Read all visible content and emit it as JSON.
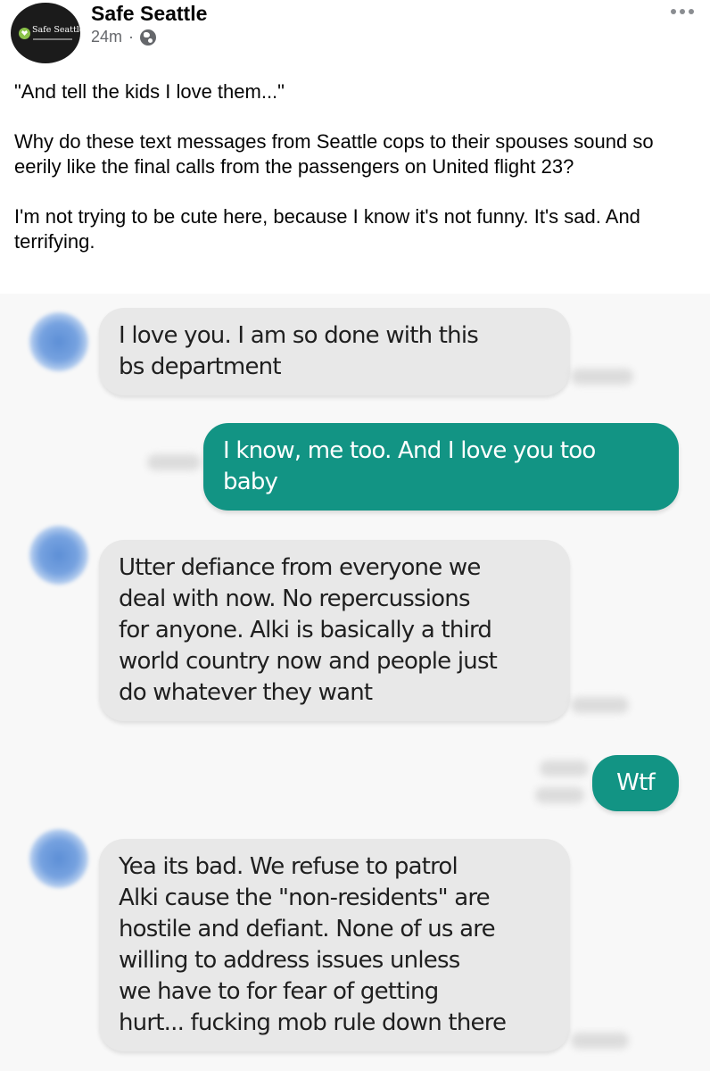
{
  "post": {
    "page_name": "Safe Seattle",
    "logo_text": "Safe Seattle",
    "time_ago": "24m",
    "separator": "·",
    "audience_icon": "globe-icon",
    "menu_icon": "more-horizontal-icon",
    "paragraphs": [
      "\"And tell the kids I love them...\"",
      "Why do these text messages from Seattle cops to their spouses sound so eerily like the final calls from the passengers on United flight 23?",
      "I'm not trying to be cute here, because I know it's not funny. It's sad. And terrifying."
    ]
  },
  "conversation": {
    "colors": {
      "incoming_bubble": "#e8e8e8",
      "outgoing_bubble": "#129484",
      "background": "#f8f8f8"
    },
    "messages": [
      {
        "direction": "incoming",
        "lines": [
          "I love you. I am so done with this",
          "bs department"
        ]
      },
      {
        "direction": "outgoing",
        "lines": [
          "I know, me too. And I love you too",
          "baby"
        ]
      },
      {
        "direction": "incoming",
        "lines": [
          "Utter defiance from everyone we",
          "deal with now. No repercussions",
          "for anyone. Alki is basically a third",
          "world country now and people just",
          "do whatever they want"
        ]
      },
      {
        "direction": "outgoing",
        "lines": [
          "Wtf"
        ]
      },
      {
        "direction": "incoming",
        "lines": [
          "Yea its bad. We refuse to patrol",
          "Alki cause the \"non-residents\" are",
          "hostile and defiant. None of us are",
          "willing to address issues unless",
          "we have to for fear of getting",
          "hurt... fucking mob rule down there"
        ]
      }
    ]
  }
}
